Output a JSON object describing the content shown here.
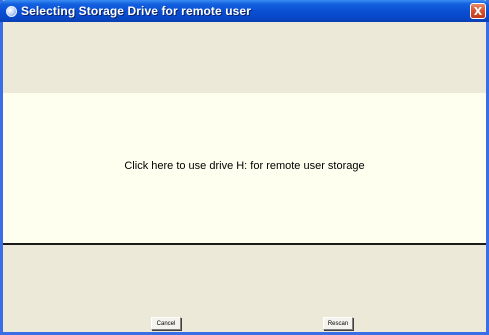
{
  "window": {
    "title": "Selecting Storage Drive for remote user",
    "close_symbol": "X"
  },
  "main": {
    "drive_option_label": "Click here to use drive H: for remote user storage"
  },
  "buttons": {
    "cancel_label": "Cancel",
    "rescan_label": "Rescan"
  },
  "colors": {
    "titlebar": "#0a4fd4",
    "window_bg": "#ece9d8",
    "option_bg": "#fffff0",
    "close_button": "#d6512d"
  },
  "icons": {
    "title_icon": "app-icon",
    "close_icon": "close-icon"
  }
}
